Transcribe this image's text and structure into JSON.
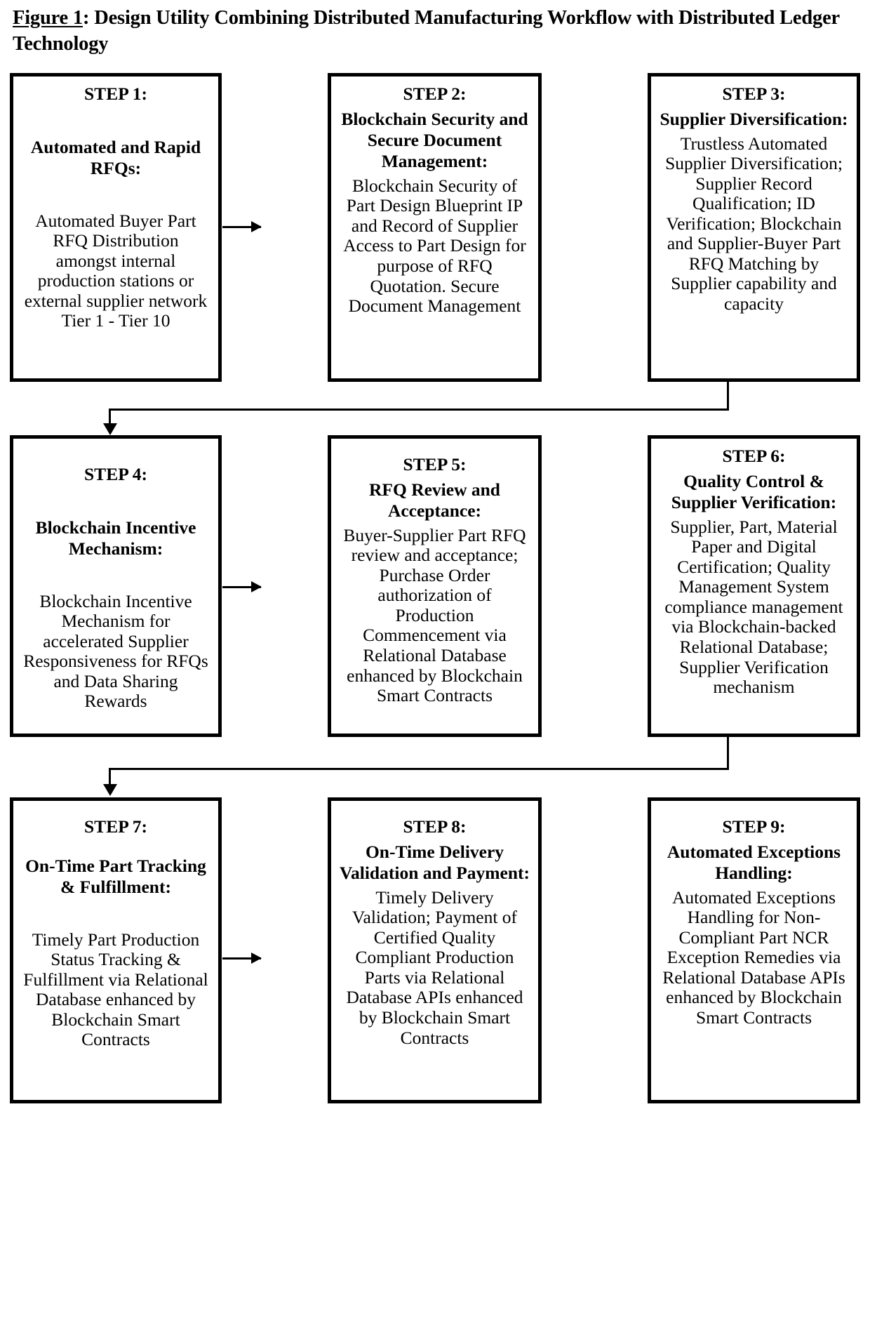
{
  "figure": {
    "label": "Figure 1",
    "title_rest": ": Design Utility Combining Distributed Manufacturing Workflow with Distributed Ledger Technology"
  },
  "colors": {
    "box_border": "#000000",
    "background": "#ffffff",
    "text": "#000000"
  },
  "steps": [
    {
      "head": "STEP 1:",
      "sub": "Automated and Rapid RFQs:",
      "body": "Automated Buyer Part RFQ Distribution amongst internal production stations or external supplier network Tier 1 - Tier 10"
    },
    {
      "head": "STEP 2:",
      "sub": "Blockchain Security and Secure Document Management:",
      "body": "Blockchain Security of Part Design Blueprint IP and Record of Supplier Access to Part Design for purpose of RFQ Quotation. Secure Document Management"
    },
    {
      "head": "STEP 3:",
      "sub": "Supplier Diversification:",
      "body": "Trustless Automated Supplier Diversification; Supplier Record Qualification; ID Verification; Blockchain and Supplier-Buyer Part RFQ Matching by Supplier capability and capacity"
    },
    {
      "head": "STEP 4:",
      "sub": "Blockchain Incentive Mechanism:",
      "body": "Blockchain Incentive Mechanism for accelerated Supplier Responsiveness for RFQs and Data Sharing Rewards"
    },
    {
      "head": "STEP 5:",
      "sub": "RFQ Review and Acceptance:",
      "body": "Buyer-Supplier Part RFQ review and acceptance; Purchase Order authorization of Production Commencement via Relational Database enhanced by Blockchain Smart Contracts"
    },
    {
      "head": "STEP 6:",
      "sub": "Quality Control & Supplier Verification:",
      "body": "Supplier, Part, Material Paper and Digital Certification; Quality Management System compliance management via Blockchain-backed Relational Database; Supplier Verification mechanism"
    },
    {
      "head": "STEP 7:",
      "sub": "On-Time Part Tracking & Fulfillment:",
      "body": "Timely Part Production Status Tracking & Fulfillment via Relational Database enhanced by Blockchain Smart Contracts"
    },
    {
      "head": "STEP 8:",
      "sub": "On-Time Delivery Validation and Payment:",
      "body": "Timely Delivery Validation; Payment of Certified Quality Compliant Production Parts via Relational Database APIs enhanced by Blockchain Smart Contracts"
    },
    {
      "head": "STEP 9:",
      "sub": "Automated Exceptions Handling:",
      "body": "Automated Exceptions Handling for Non-Compliant Part NCR Exception Remedies via Relational Database APIs enhanced by Blockchain Smart Contracts"
    }
  ],
  "connectors": [
    {
      "name": "arrow-step1-to-step2",
      "kind": "horizontal-arrow"
    },
    {
      "name": "arrow-step2-to-step3",
      "kind": "horizontal-arrow"
    },
    {
      "name": "arrow-step3-to-step4",
      "kind": "z-wrap"
    },
    {
      "name": "arrow-step4-to-step5",
      "kind": "horizontal-arrow"
    },
    {
      "name": "arrow-step5-to-step6",
      "kind": "horizontal-arrow"
    },
    {
      "name": "arrow-step6-to-step7",
      "kind": "z-wrap"
    },
    {
      "name": "arrow-step7-to-step8",
      "kind": "horizontal-arrow"
    },
    {
      "name": "arrow-step8-to-step9",
      "kind": "horizontal-arrow"
    }
  ]
}
